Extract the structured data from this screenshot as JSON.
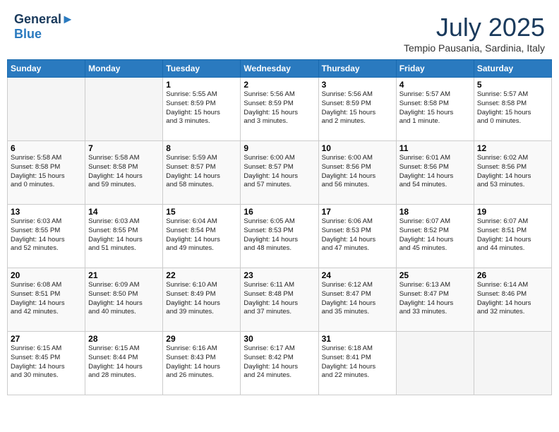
{
  "header": {
    "logo_line1": "General",
    "logo_line2": "Blue",
    "month_year": "July 2025",
    "location": "Tempio Pausania, Sardinia, Italy"
  },
  "days_of_week": [
    "Sunday",
    "Monday",
    "Tuesday",
    "Wednesday",
    "Thursday",
    "Friday",
    "Saturday"
  ],
  "weeks": [
    [
      {
        "day": "",
        "info": ""
      },
      {
        "day": "",
        "info": ""
      },
      {
        "day": "1",
        "info": "Sunrise: 5:55 AM\nSunset: 8:59 PM\nDaylight: 15 hours\nand 3 minutes."
      },
      {
        "day": "2",
        "info": "Sunrise: 5:56 AM\nSunset: 8:59 PM\nDaylight: 15 hours\nand 3 minutes."
      },
      {
        "day": "3",
        "info": "Sunrise: 5:56 AM\nSunset: 8:59 PM\nDaylight: 15 hours\nand 2 minutes."
      },
      {
        "day": "4",
        "info": "Sunrise: 5:57 AM\nSunset: 8:58 PM\nDaylight: 15 hours\nand 1 minute."
      },
      {
        "day": "5",
        "info": "Sunrise: 5:57 AM\nSunset: 8:58 PM\nDaylight: 15 hours\nand 0 minutes."
      }
    ],
    [
      {
        "day": "6",
        "info": "Sunrise: 5:58 AM\nSunset: 8:58 PM\nDaylight: 15 hours\nand 0 minutes."
      },
      {
        "day": "7",
        "info": "Sunrise: 5:58 AM\nSunset: 8:58 PM\nDaylight: 14 hours\nand 59 minutes."
      },
      {
        "day": "8",
        "info": "Sunrise: 5:59 AM\nSunset: 8:57 PM\nDaylight: 14 hours\nand 58 minutes."
      },
      {
        "day": "9",
        "info": "Sunrise: 6:00 AM\nSunset: 8:57 PM\nDaylight: 14 hours\nand 57 minutes."
      },
      {
        "day": "10",
        "info": "Sunrise: 6:00 AM\nSunset: 8:56 PM\nDaylight: 14 hours\nand 56 minutes."
      },
      {
        "day": "11",
        "info": "Sunrise: 6:01 AM\nSunset: 8:56 PM\nDaylight: 14 hours\nand 54 minutes."
      },
      {
        "day": "12",
        "info": "Sunrise: 6:02 AM\nSunset: 8:56 PM\nDaylight: 14 hours\nand 53 minutes."
      }
    ],
    [
      {
        "day": "13",
        "info": "Sunrise: 6:03 AM\nSunset: 8:55 PM\nDaylight: 14 hours\nand 52 minutes."
      },
      {
        "day": "14",
        "info": "Sunrise: 6:03 AM\nSunset: 8:55 PM\nDaylight: 14 hours\nand 51 minutes."
      },
      {
        "day": "15",
        "info": "Sunrise: 6:04 AM\nSunset: 8:54 PM\nDaylight: 14 hours\nand 49 minutes."
      },
      {
        "day": "16",
        "info": "Sunrise: 6:05 AM\nSunset: 8:53 PM\nDaylight: 14 hours\nand 48 minutes."
      },
      {
        "day": "17",
        "info": "Sunrise: 6:06 AM\nSunset: 8:53 PM\nDaylight: 14 hours\nand 47 minutes."
      },
      {
        "day": "18",
        "info": "Sunrise: 6:07 AM\nSunset: 8:52 PM\nDaylight: 14 hours\nand 45 minutes."
      },
      {
        "day": "19",
        "info": "Sunrise: 6:07 AM\nSunset: 8:51 PM\nDaylight: 14 hours\nand 44 minutes."
      }
    ],
    [
      {
        "day": "20",
        "info": "Sunrise: 6:08 AM\nSunset: 8:51 PM\nDaylight: 14 hours\nand 42 minutes."
      },
      {
        "day": "21",
        "info": "Sunrise: 6:09 AM\nSunset: 8:50 PM\nDaylight: 14 hours\nand 40 minutes."
      },
      {
        "day": "22",
        "info": "Sunrise: 6:10 AM\nSunset: 8:49 PM\nDaylight: 14 hours\nand 39 minutes."
      },
      {
        "day": "23",
        "info": "Sunrise: 6:11 AM\nSunset: 8:48 PM\nDaylight: 14 hours\nand 37 minutes."
      },
      {
        "day": "24",
        "info": "Sunrise: 6:12 AM\nSunset: 8:47 PM\nDaylight: 14 hours\nand 35 minutes."
      },
      {
        "day": "25",
        "info": "Sunrise: 6:13 AM\nSunset: 8:47 PM\nDaylight: 14 hours\nand 33 minutes."
      },
      {
        "day": "26",
        "info": "Sunrise: 6:14 AM\nSunset: 8:46 PM\nDaylight: 14 hours\nand 32 minutes."
      }
    ],
    [
      {
        "day": "27",
        "info": "Sunrise: 6:15 AM\nSunset: 8:45 PM\nDaylight: 14 hours\nand 30 minutes."
      },
      {
        "day": "28",
        "info": "Sunrise: 6:15 AM\nSunset: 8:44 PM\nDaylight: 14 hours\nand 28 minutes."
      },
      {
        "day": "29",
        "info": "Sunrise: 6:16 AM\nSunset: 8:43 PM\nDaylight: 14 hours\nand 26 minutes."
      },
      {
        "day": "30",
        "info": "Sunrise: 6:17 AM\nSunset: 8:42 PM\nDaylight: 14 hours\nand 24 minutes."
      },
      {
        "day": "31",
        "info": "Sunrise: 6:18 AM\nSunset: 8:41 PM\nDaylight: 14 hours\nand 22 minutes."
      },
      {
        "day": "",
        "info": ""
      },
      {
        "day": "",
        "info": ""
      }
    ]
  ]
}
